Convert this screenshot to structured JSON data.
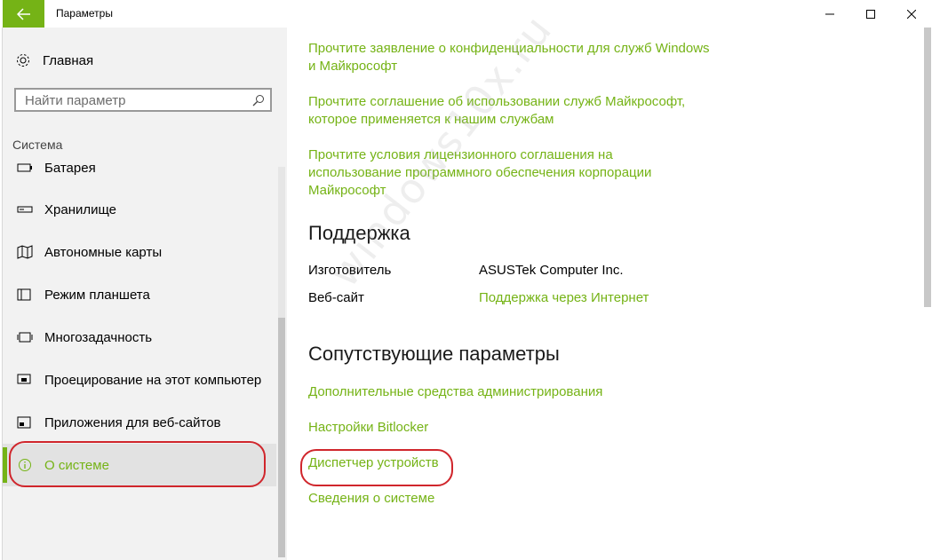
{
  "window": {
    "title": "Параметры",
    "back_icon": "arrow-left-icon",
    "minimize_icon": "minimize-icon",
    "maximize_icon": "maximize-icon",
    "close_icon": "close-icon"
  },
  "sidebar": {
    "home_label": "Главная",
    "search_placeholder": "Найти параметр",
    "section_label": "Система",
    "items": [
      {
        "label": "Батарея",
        "icon": "battery-icon"
      },
      {
        "label": "Хранилище",
        "icon": "storage-icon"
      },
      {
        "label": "Автономные карты",
        "icon": "map-icon"
      },
      {
        "label": "Режим планшета",
        "icon": "tablet-mode-icon"
      },
      {
        "label": "Многозадачность",
        "icon": "multitasking-icon"
      },
      {
        "label": "Проецирование на этот компьютер",
        "icon": "projecting-icon"
      },
      {
        "label": "Приложения для веб-сайтов",
        "icon": "apps-websites-icon"
      },
      {
        "label": "О системе",
        "icon": "info-icon",
        "selected": true
      }
    ]
  },
  "main": {
    "privacy_links": [
      "Прочтите заявление о конфиденциальности для служб Windows и Майкрософт",
      "Прочтите соглашение об использовании служб Майкрософт, которое применяется к нашим службам",
      "Прочтите условия лицензионного соглашения на использование программного обеспечения корпорации Майкрософт"
    ],
    "support": {
      "heading": "Поддержка",
      "manufacturer_label": "Изготовитель",
      "manufacturer_value": "ASUSTek Computer Inc.",
      "website_label": "Веб-сайт",
      "website_value": "Поддержка через Интернет"
    },
    "related": {
      "heading": "Сопутствующие параметры",
      "links": [
        "Дополнительные средства администрирования",
        "Настройки Bitlocker",
        "Диспетчер устройств",
        "Сведения о системе"
      ]
    }
  },
  "watermark": "windows10x.ru",
  "colors": {
    "accent": "#75b316",
    "highlight": "#d0262c"
  }
}
